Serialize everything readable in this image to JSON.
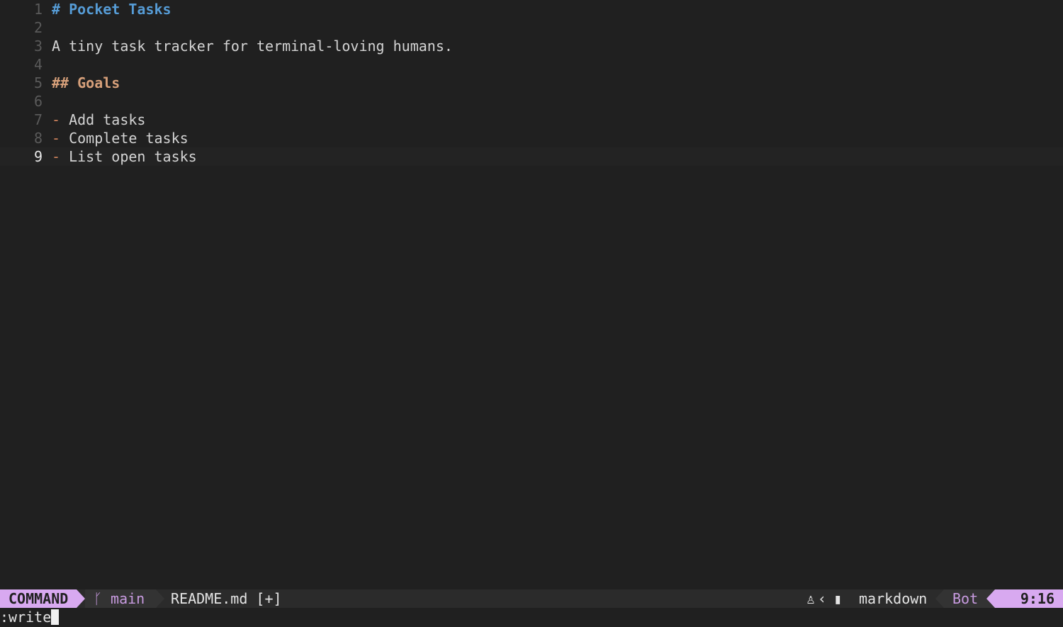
{
  "editor": {
    "lines": [
      {
        "num": "1",
        "parts": [
          {
            "cls": "h1",
            "text": "# Pocket Tasks"
          }
        ]
      },
      {
        "num": "2",
        "parts": []
      },
      {
        "num": "3",
        "parts": [
          {
            "cls": "text",
            "text": "A tiny task tracker for terminal-loving humans."
          }
        ]
      },
      {
        "num": "4",
        "parts": []
      },
      {
        "num": "5",
        "parts": [
          {
            "cls": "h2",
            "text": "## Goals"
          }
        ]
      },
      {
        "num": "6",
        "parts": []
      },
      {
        "num": "7",
        "parts": [
          {
            "cls": "bullet",
            "text": "-"
          },
          {
            "cls": "text",
            "text": " Add tasks"
          }
        ]
      },
      {
        "num": "8",
        "parts": [
          {
            "cls": "bullet",
            "text": "-"
          },
          {
            "cls": "text",
            "text": " Complete tasks"
          }
        ]
      },
      {
        "num": "9",
        "parts": [
          {
            "cls": "bullet",
            "text": "-"
          },
          {
            "cls": "text",
            "text": " List open tasks"
          }
        ],
        "current": true
      }
    ]
  },
  "statusline": {
    "mode": "COMMAND",
    "branch": "main",
    "filename": "README.md [+]",
    "filetype": "markdown",
    "scroll": "Bot",
    "cursor_pos": "9:16",
    "icons": [
      "git-branch-icon",
      "linux-icon",
      "chevron-left-icon",
      "file-icon"
    ],
    "colors": {
      "accent": "#d8a9f0",
      "heading1": "#569cd6",
      "heading2": "#d7a07a",
      "bullet": "#d7875f"
    }
  },
  "cmdline": {
    "text": ":write"
  }
}
